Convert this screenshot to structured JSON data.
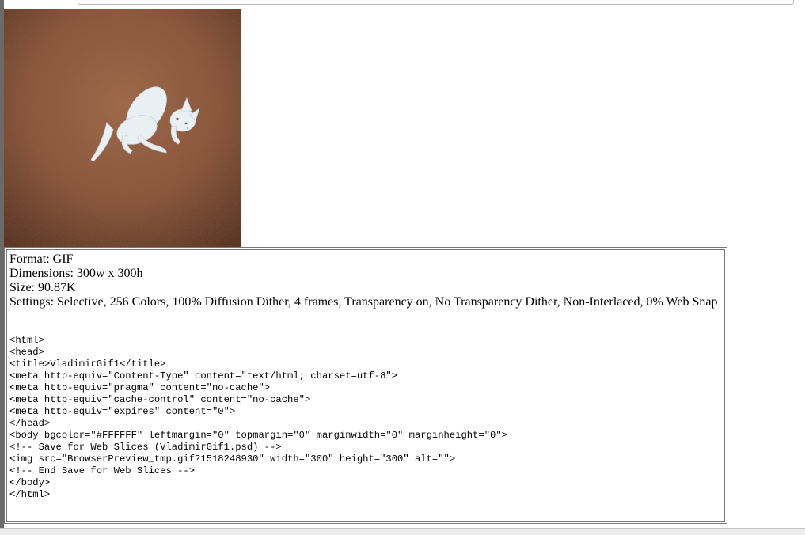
{
  "preview": {
    "image_description_icon": "cat-on-carpet-photo"
  },
  "info": {
    "format": "Format: GIF",
    "dimensions": "Dimensions: 300w x 300h",
    "size": "Size: 90.87K",
    "settings": "Settings: Selective, 256 Colors, 100% Diffusion Dither, 4 frames, Transparency on, No Transparency Dither, Non-Interlaced, 0% Web Snap"
  },
  "code": {
    "lines": [
      "<html>",
      "<head>",
      "<title>VladimirGif1</title>",
      "<meta http-equiv=\"Content-Type\" content=\"text/html; charset=utf-8\">",
      "<meta http-equiv=\"pragma\" content=\"no-cache\">",
      "<meta http-equiv=\"cache-control\" content=\"no-cache\">",
      "<meta http-equiv=\"expires\" content=\"0\">",
      "</head>",
      "<body bgcolor=\"#FFFFFF\" leftmargin=\"0\" topmargin=\"0\" marginwidth=\"0\" marginheight=\"0\">",
      "<!-- Save for Web Slices (VladimirGif1.psd) -->",
      "<img src=\"BrowserPreview_tmp.gif?1518248930\" width=\"300\" height=\"300\" alt=\"\">",
      "<!-- End Save for Web Slices -->",
      "</body>",
      "</html>"
    ]
  }
}
